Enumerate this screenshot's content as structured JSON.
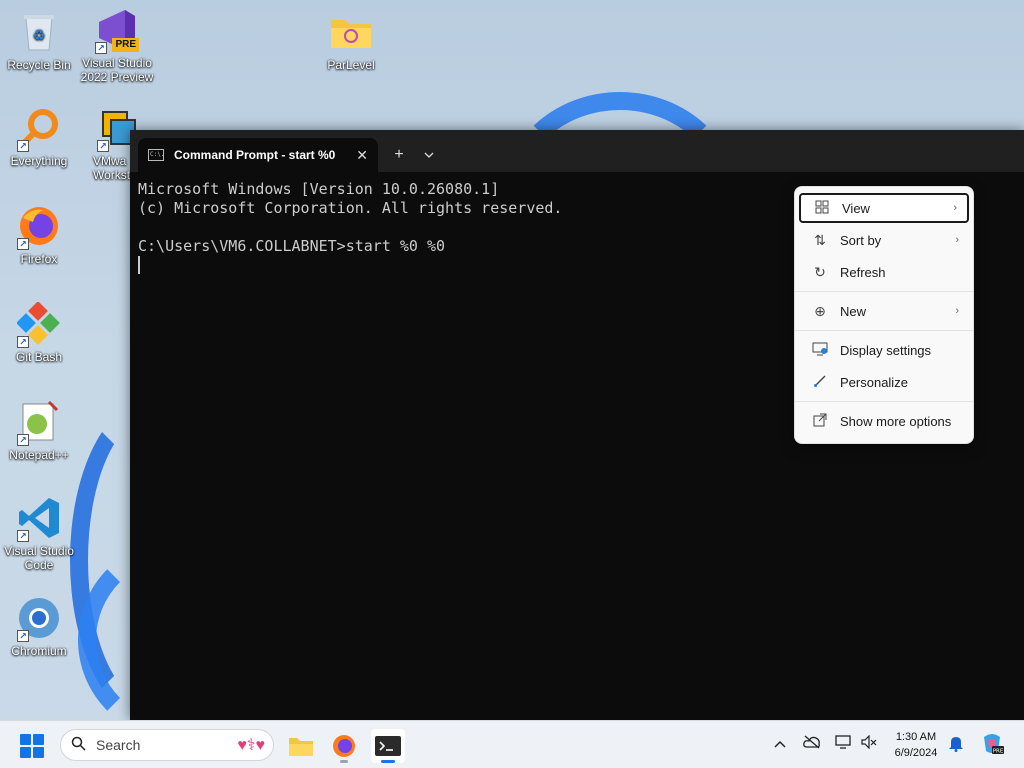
{
  "desktop": {
    "icons": [
      {
        "label": "Recycle Bin"
      },
      {
        "label": "Visual Studio 2022 Preview"
      },
      {
        "label": "ParLevel"
      },
      {
        "label": "Everything"
      },
      {
        "label": "VMwa Worksta"
      },
      {
        "label": "Firefox"
      },
      {
        "label": "Git Bash"
      },
      {
        "label": "Notepad++"
      },
      {
        "label": "Visual Studio Code"
      },
      {
        "label": "Chromium"
      }
    ],
    "vs_badge": "PRE"
  },
  "terminal": {
    "tab_title": "Command Prompt - start  %0",
    "tab_icon_text": "C:\\.",
    "new_tab": "+",
    "dropdown": "⌄",
    "close": "✕",
    "lines": [
      "Microsoft Windows [Version 10.0.26080.1]",
      "(c) Microsoft Corporation. All rights reserved.",
      "",
      "C:\\Users\\VM6.COLLABNET>start %0 %0"
    ]
  },
  "context_menu": {
    "items": [
      {
        "label": "View",
        "icon": "grid-icon",
        "submenu": true
      },
      {
        "label": "Sort by",
        "icon": "sort-icon",
        "submenu": true
      },
      {
        "label": "Refresh",
        "icon": "refresh-icon",
        "submenu": false
      },
      {
        "label": "New",
        "icon": "plus-circle-icon",
        "submenu": true
      },
      {
        "label": "Display settings",
        "icon": "display-icon",
        "submenu": false
      },
      {
        "label": "Personalize",
        "icon": "brush-icon",
        "submenu": false
      },
      {
        "label": "Show more options",
        "icon": "open-external-icon",
        "submenu": false
      }
    ],
    "chevron": "›"
  },
  "taskbar": {
    "search_placeholder": "Search",
    "time": "1:30 AM",
    "date": "6/9/2024"
  },
  "colors": {
    "accent": "#1473e6",
    "terminal_bg": "#0c0c0c",
    "menu_bg": "#f9f9f9"
  }
}
